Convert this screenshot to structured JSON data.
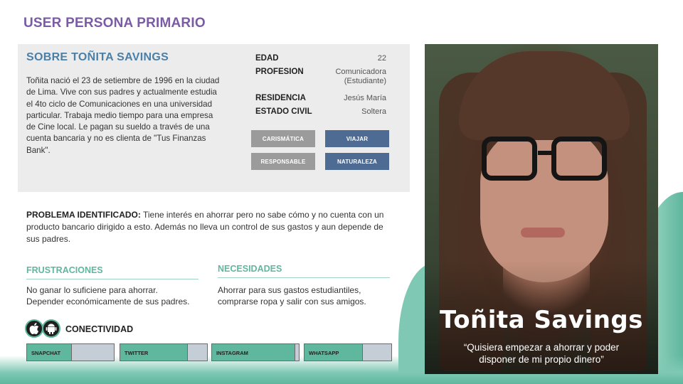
{
  "page": {
    "title": "USER PERSONA PRIMARIO"
  },
  "about": {
    "heading": "SOBRE TOÑITA SAVINGS",
    "bio": "Toñita nació el 23 de setiembre de 1996 en la ciudad de Lima. Vive con sus padres y actualmente estudia el 4to ciclo de Comunicaciones en una universidad particular. Trabaja medio tiempo para una empresa de Cine local. Le pagan su sueldo a través de una cuenta bancaria y no es clienta de \"Tus Finanzas Bank\"."
  },
  "facts": {
    "age": {
      "label": "EDAD",
      "value": "22"
    },
    "profession": {
      "label": "PROFESION",
      "value": "Comunicadora",
      "value_sub": "(Estudiante)"
    },
    "residence": {
      "label": "RESIDENCIA",
      "value": "Jesús María"
    },
    "civil_status": {
      "label": "ESTADO CIVIL",
      "value": "Soltera"
    }
  },
  "traits": [
    "CARISMÁTICA",
    "VIAJAR",
    "RESPONSABLE",
    "NATURALEZA"
  ],
  "problem": {
    "label": "PROBLEMA IDENTIFICADO:",
    "text": " Tiene interés en ahorrar pero no sabe cómo y no cuenta con un producto bancario dirigido a esto. Además no lleva un control de sus gastos y aun depende de sus padres."
  },
  "frustrations": {
    "heading": "FRUSTRACIONES",
    "lines": [
      "No ganar lo suficiene para ahorrar.",
      "Depender económicamente de sus padres."
    ]
  },
  "needs": {
    "heading": "NECESIDADES",
    "lines": [
      "Ahorrar para sus gastos estudiantiles,",
      "comprarse ropa y salir con sus amigos."
    ]
  },
  "connectivity": {
    "label": "CONECTIVIDAD",
    "os_icons": [
      "apple-icon",
      "android-icon"
    ],
    "apps": [
      {
        "name": "SNAPCHAT",
        "level": 0.52
      },
      {
        "name": "TWITTER",
        "level": 0.78
      },
      {
        "name": "INSTAGRAM",
        "level": 0.96
      },
      {
        "name": "WHATSAPP",
        "level": 0.67
      }
    ]
  },
  "persona": {
    "name": "Toñita Savings",
    "quote_line1": "“Quisiera empezar a ahorrar y poder",
    "quote_line2": "disponer de mi propio dinero”"
  },
  "colors": {
    "title": "#7b5aa6",
    "heading_blue": "#4a7fa8",
    "teal": "#5fb79d",
    "trait_gray": "#9b9b9b",
    "trait_blue": "#4e6b93"
  }
}
